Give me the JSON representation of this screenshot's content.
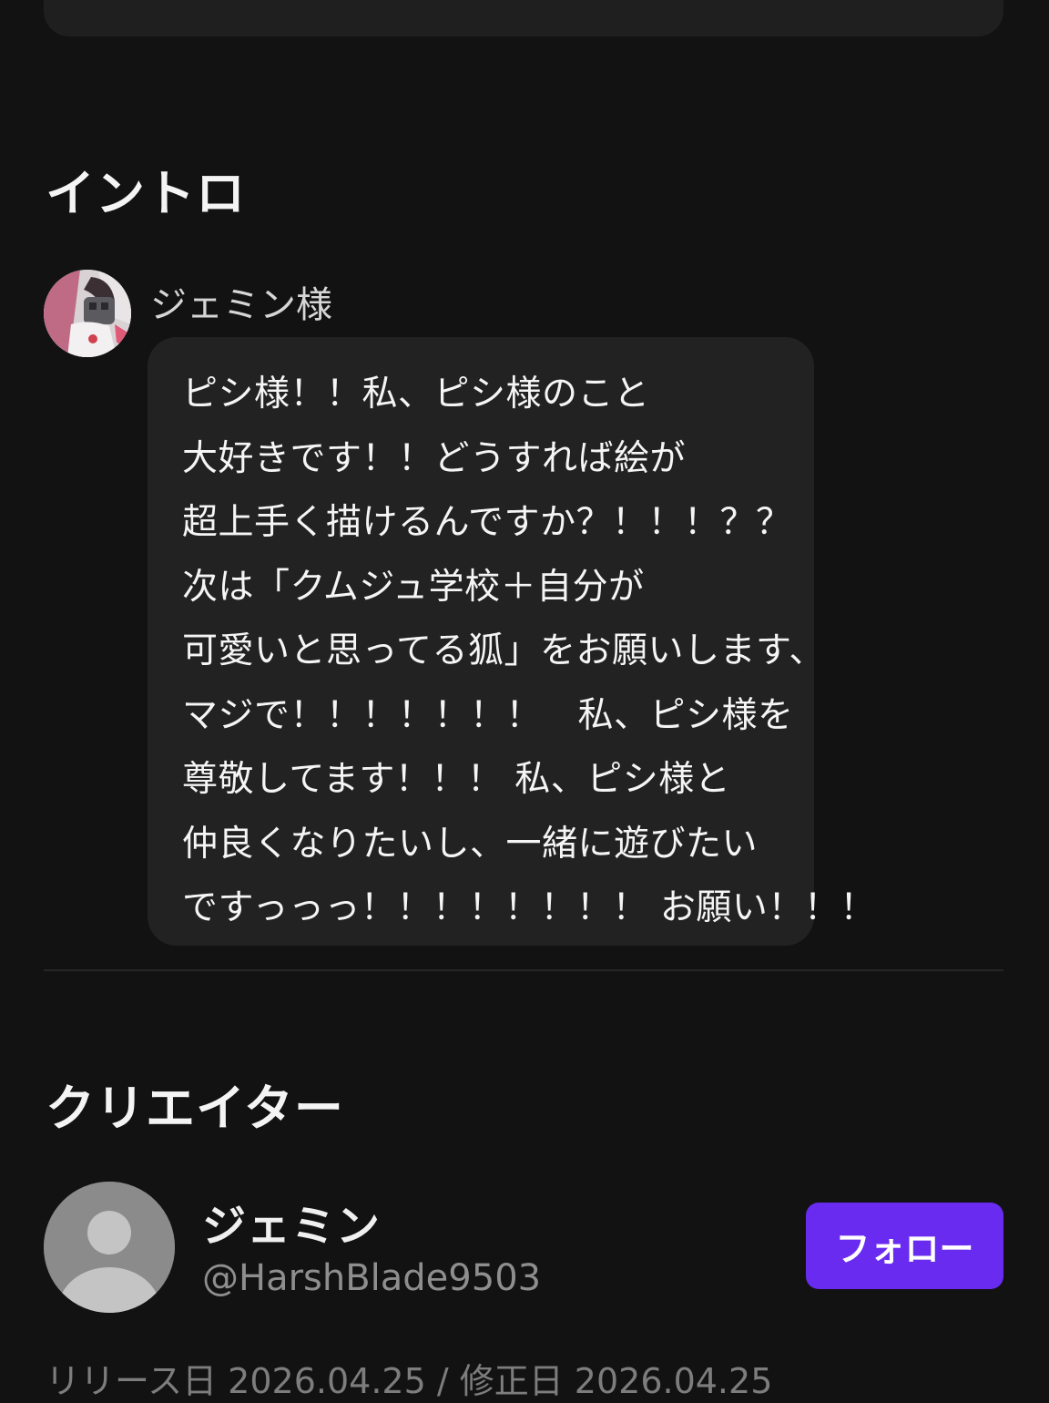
{
  "intro": {
    "title": "イントロ",
    "character_name": "ジェミン様",
    "message_lines": [
      "ピシ様！！私、ピシ様のこと",
      "大好きです！！どうすれば絵が",
      "超上手く描けるんですか？！！！？？",
      "次は「クムジュ学校＋自分が",
      "可愛いと思ってる狐」をお願いします、",
      "マジで！！！！！！！　私、ピシ様を",
      "尊敬してます！！！ 私、ピシ様と",
      "仲良くなりたいし、一緒に遊びたい",
      "ですっっっ！！！！！！！！ お願い！！！"
    ]
  },
  "creator": {
    "title": "クリエイター",
    "name": "ジェミン",
    "handle": "@HarshBlade9503",
    "follow_label": "フォロー",
    "avatar_icon": "default-user-icon"
  },
  "meta": {
    "release_line": "リリース日 2026.04.25 / 修正日 2026.04.25"
  },
  "colors": {
    "background": "#121212",
    "bubble": "#222222",
    "accent": "#6a2bf0"
  }
}
